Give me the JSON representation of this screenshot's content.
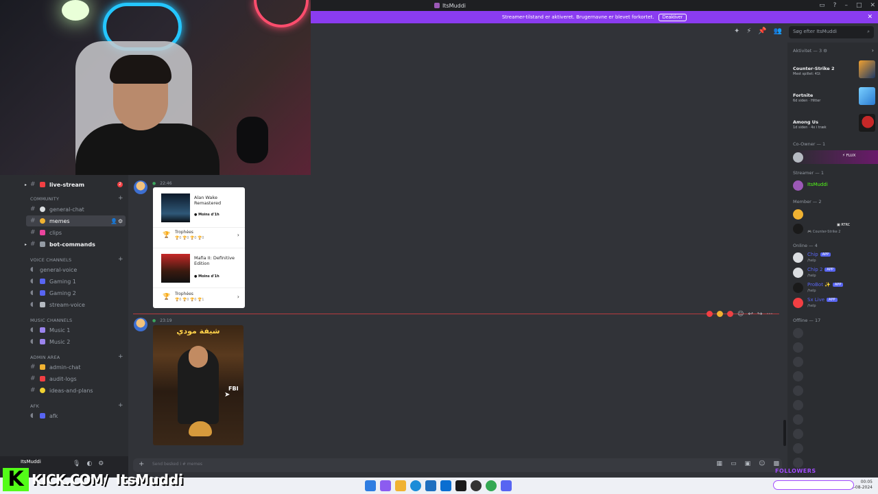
{
  "window": {
    "title": "ItsMuddi",
    "streamer_notice": "Streamer-tilstand er aktiveret. Brugernavne er blevet forkortet.",
    "deactivate_label": "Deaktiver",
    "close_glyph": "✕"
  },
  "header": {
    "search_placeholder": "Søg efter ItsMuddi",
    "search_icon": "⌕",
    "tools": [
      "✦",
      "⚡",
      "📌",
      "👥"
    ]
  },
  "sidebar": {
    "channels": {
      "live_stream": "live-stream",
      "live_stream_badge": "2",
      "community": "COMMUNITY",
      "general_chat": "general-chat",
      "memes": "memes",
      "clips": "clips",
      "bot_commands": "bot-commands",
      "voice_channels": "VOICE CHANNELS",
      "general_voice": "general-voice",
      "gaming1": "Gaming 1",
      "gaming2": "Gaming 2",
      "stream_voice": "stream-voice",
      "music_channels": "MUSIC CHANNELS",
      "music1": "Music 1",
      "music2": "Music 2",
      "admin_area": "ADMIN AREA",
      "admin_chat": "admin-chat",
      "audit_logs": "audit-logs",
      "ideas": "ideas-and-plans",
      "afk_cat": "AFK",
      "afk": "afk"
    },
    "user": {
      "name": "ItsMuddi"
    }
  },
  "overlay": {
    "kick_logo": "K",
    "kick_url": "KICK.COM/",
    "kick_name": "ItsMuddi",
    "followers": "FOLLOWERS"
  },
  "chat": {
    "msg1_time": "22:46",
    "games": [
      {
        "title": "Alan Wake Remastered",
        "status": "Moins d'1h",
        "trophies_label": "Trophées",
        "trophies_counts": "🏆0 🏆0 🏆0 🏆0"
      },
      {
        "title": "Mafia II: Definitive Edition",
        "status": "Moins d'1h",
        "trophies_label": "Trophées",
        "trophies_counts": "🏆0 🏆0 🏆0 🏆1"
      }
    ],
    "msg2_time": "23:19",
    "image_title": "شيفة مودي",
    "image_label": "FBI",
    "composer_placeholder": "Send besked i # memes"
  },
  "members": {
    "activity_header": "Aktivitet — 3",
    "activities": [
      {
        "game": "Counter-Strike 2",
        "meta": "Mest spillet: 41t"
      },
      {
        "game": "Fortnite",
        "meta": "6d siden · Hitter"
      },
      {
        "game": "Among Us",
        "meta": "1d siden · 4x i træk"
      }
    ],
    "coowner_header": "Co-Owner — 1",
    "coowner_tag": "FLUX",
    "streamer_header": "Streamer — 1",
    "streamer_name": "ItsMuddi",
    "member_header": "Member — 2",
    "member2_tag": "RTRC",
    "member2_status": "Counter-Strike 2",
    "online_header": "Online — 4",
    "bots": [
      {
        "name": "Chip",
        "tag": "APP",
        "status": "/help"
      },
      {
        "name": "Chip 2",
        "tag": "APP",
        "status": "/help"
      },
      {
        "name": "ProBot",
        "tag": "APP",
        "status": "/help"
      },
      {
        "name": "Sx Live",
        "tag": "APP",
        "status": "/help"
      }
    ],
    "offline_header": "Offline — 17"
  },
  "taskbar": {
    "time": "00:05",
    "date": "04-08-2024"
  },
  "colors": {
    "streamer_bar": "#8a3cf0",
    "kick_green": "#53fc18",
    "online_green": "#3ba55d",
    "bot_blue": "#5865f2"
  }
}
